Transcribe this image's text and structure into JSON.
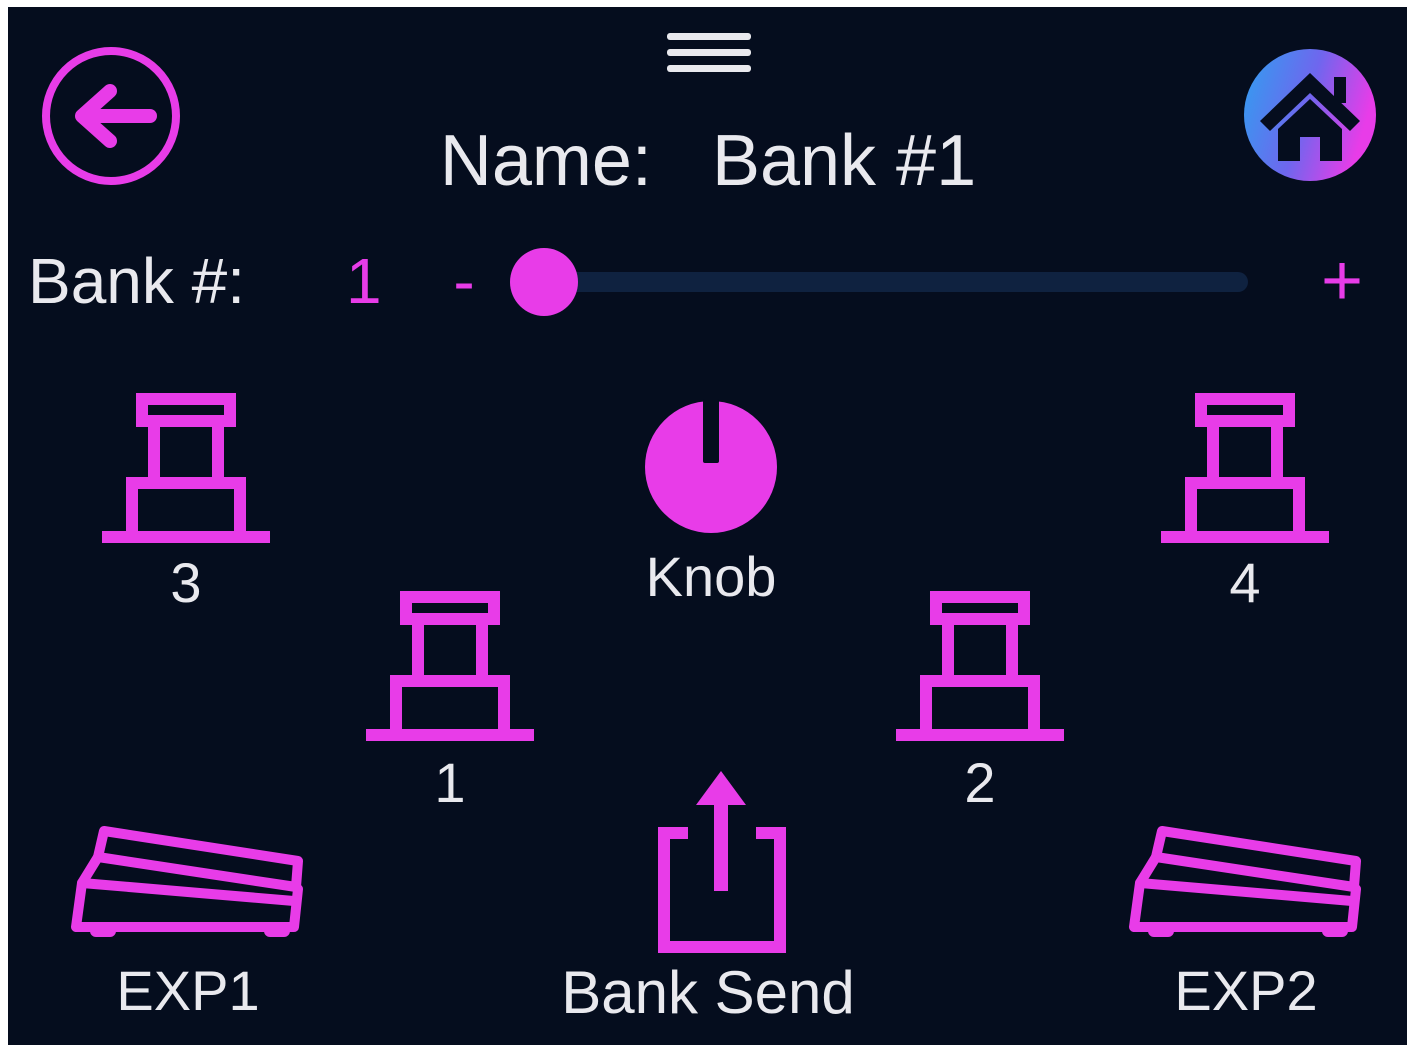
{
  "colors": {
    "background": "#050d1e",
    "accent": "#e83ce8",
    "text": "#e9e9ee",
    "track": "#0f2240"
  },
  "header": {
    "menu_icon": "hamburger-menu-icon",
    "back_icon": "back-arrow-circle-icon",
    "home_icon": "home-icon",
    "name_label": "Name:",
    "name_value": "Bank #1"
  },
  "bank_selector": {
    "label": "Bank #:",
    "value": "1",
    "decrement": "-",
    "increment": "+",
    "slider_level": 0
  },
  "controls": {
    "footswitch_3": {
      "icon": "footswitch-icon",
      "label": "3"
    },
    "footswitch_4": {
      "icon": "footswitch-icon",
      "label": "4"
    },
    "footswitch_1": {
      "icon": "footswitch-icon",
      "label": "1"
    },
    "footswitch_2": {
      "icon": "footswitch-icon",
      "label": "2"
    },
    "knob": {
      "icon": "knob-icon",
      "label": "Knob"
    },
    "exp1": {
      "icon": "expression-pedal-icon",
      "label": "EXP1"
    },
    "exp2": {
      "icon": "expression-pedal-icon",
      "label": "EXP2"
    },
    "bank_send": {
      "icon": "share-upload-icon",
      "label": "Bank Send"
    }
  }
}
